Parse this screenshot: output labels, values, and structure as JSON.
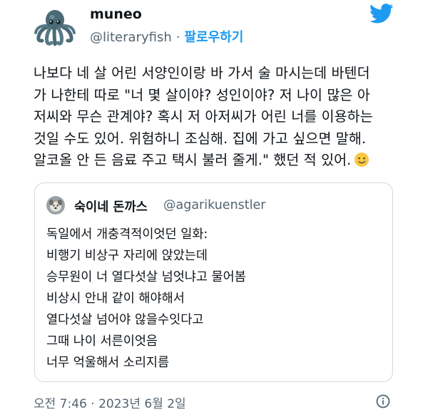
{
  "author": {
    "display_name": "muneo",
    "handle": "@literaryfish",
    "separator": "·",
    "follow_label": "팔로우하기"
  },
  "tweet": {
    "lines": [
      "나보다 네 살 어린 서양인이랑 바 가서 술 마시는데 바텐더",
      "가 나한테 따로 \"너 몇 살이야? 성인이야? 저 나이 많은 아",
      "저씨와 무슨 관계야? 혹시 저 아저씨가 어린 너를 이용하는",
      "것일 수도 있어. 위험하니 조심해. 집에 가고 싶으면 말해.",
      "알코올 안 든 음료 주고 택시 불러 줄게.\" 했던 적 있어."
    ],
    "emoji_icon": "tearful-smile-emoji"
  },
  "quote": {
    "display_name": "숙이네 돈까스",
    "handle": "@agarikuenstler",
    "lines": [
      "독일에서 개충격적이엇던 일화:",
      "비행기 비상구 자리에 앉았는데",
      "승무원이 너 열다섯살 넘엇냐고 물어봄",
      "비상시 안내 같이 해야해서",
      "열다섯살 넘어야 않을수잇다고",
      "그때 나이 서른이엇음",
      "너무 억울해서 소리지름"
    ]
  },
  "footer": {
    "timestamp": "오전 7:46 · 2023년 6월 2일",
    "info_icon": "info-icon"
  },
  "colors": {
    "accent": "#1d9bf0",
    "secondary_text": "#536471",
    "border": "#cfd9de"
  }
}
